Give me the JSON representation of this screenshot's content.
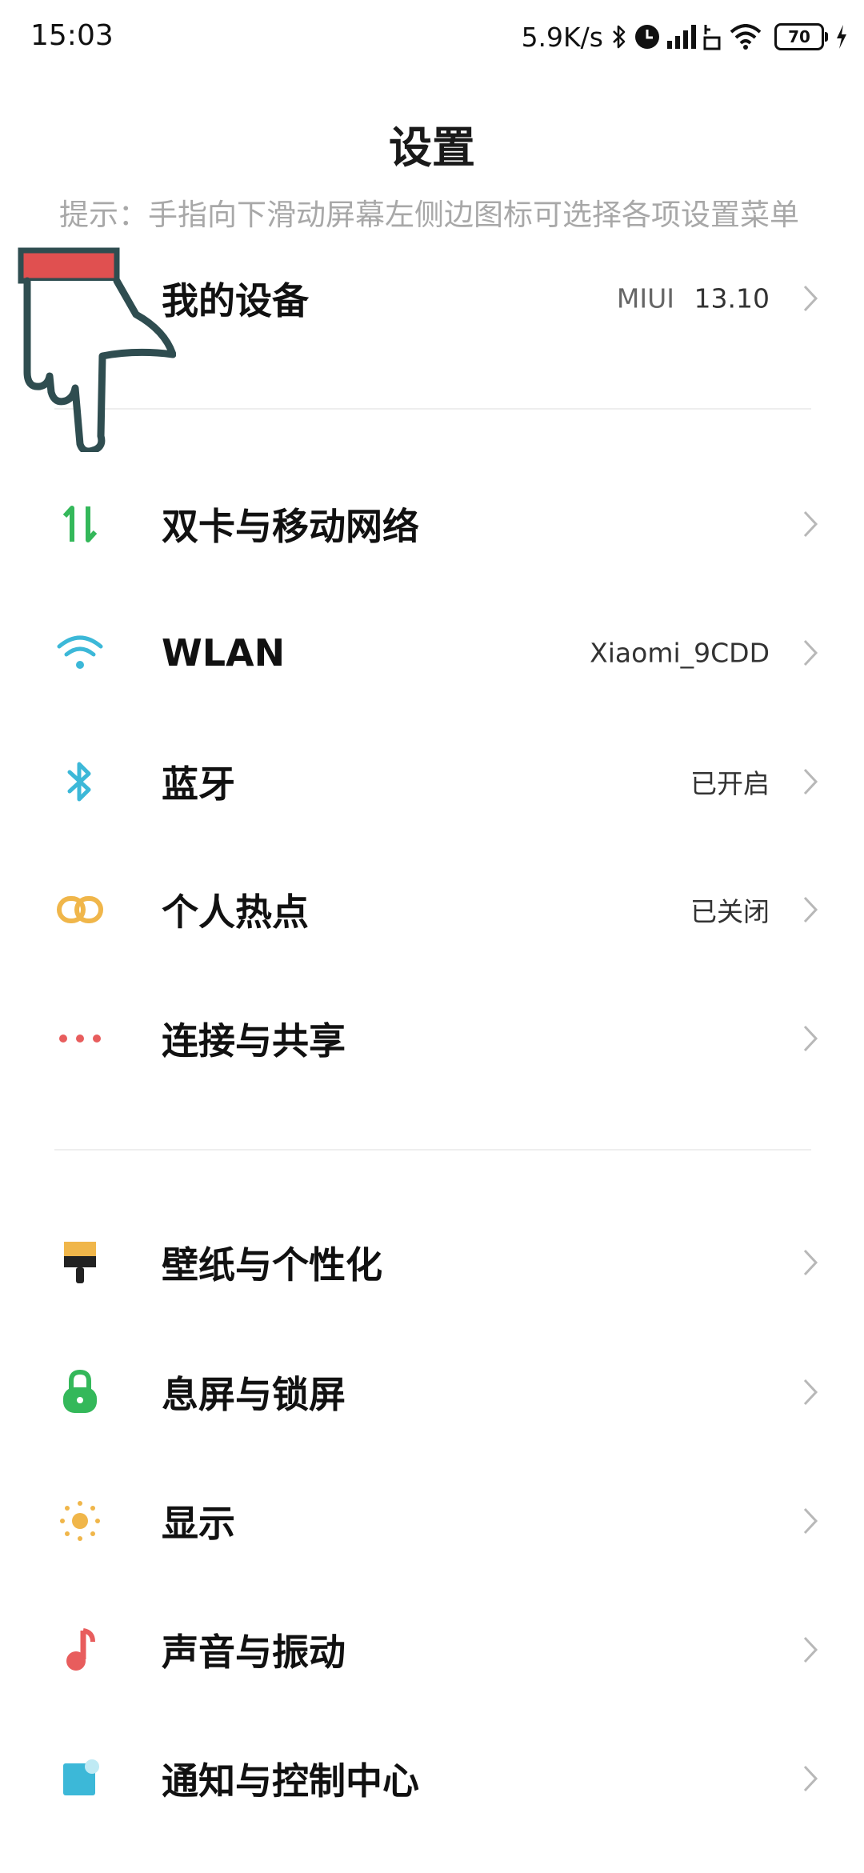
{
  "status_bar": {
    "time": "15:03",
    "net_speed": "5.9K/s",
    "battery_level": "70",
    "icons": [
      "bluetooth-icon",
      "alarm-icon",
      "signal-icon",
      "data-icon",
      "wifi-icon",
      "battery-icon",
      "charging-icon"
    ]
  },
  "header": {
    "title": "设置",
    "hint": "提示：手指向下滑动屏幕左侧边图标可选择各项设置菜单"
  },
  "rows": {
    "my_device": {
      "label": "我的设备",
      "value_prefix": "MIUI",
      "value_version": "13.10",
      "icon": "android-icon"
    },
    "sim": {
      "label": "双卡与移动网络",
      "icon": "mobile-data-icon"
    },
    "wlan": {
      "label": "WLAN",
      "value": "Xiaomi_9CDD",
      "icon": "wifi-icon"
    },
    "bluetooth": {
      "label": "蓝牙",
      "value": "已开启",
      "icon": "bluetooth-icon"
    },
    "hotspot": {
      "label": "个人热点",
      "value": "已关闭",
      "icon": "hotspot-link-icon"
    },
    "connection": {
      "label": "连接与共享",
      "icon": "more-dots-icon"
    },
    "wallpaper": {
      "label": "壁纸与个性化",
      "icon": "paint-brush-icon"
    },
    "lockscreen": {
      "label": "息屏与锁屏",
      "icon": "lock-icon"
    },
    "display": {
      "label": "显示",
      "icon": "brightness-icon"
    },
    "sound": {
      "label": "声音与振动",
      "icon": "music-note-icon"
    },
    "notification": {
      "label": "通知与控制中心",
      "icon": "notification-icon"
    }
  },
  "colors": {
    "accent_green": "#34b85a",
    "wifi_blue": "#3cb8d8",
    "hotspot_orange": "#f0b64a",
    "dots_red": "#e85d5d",
    "hint_gray": "#a8a8a8",
    "overlay_red": "#e05050",
    "overlay_dark": "#2f4d50"
  }
}
